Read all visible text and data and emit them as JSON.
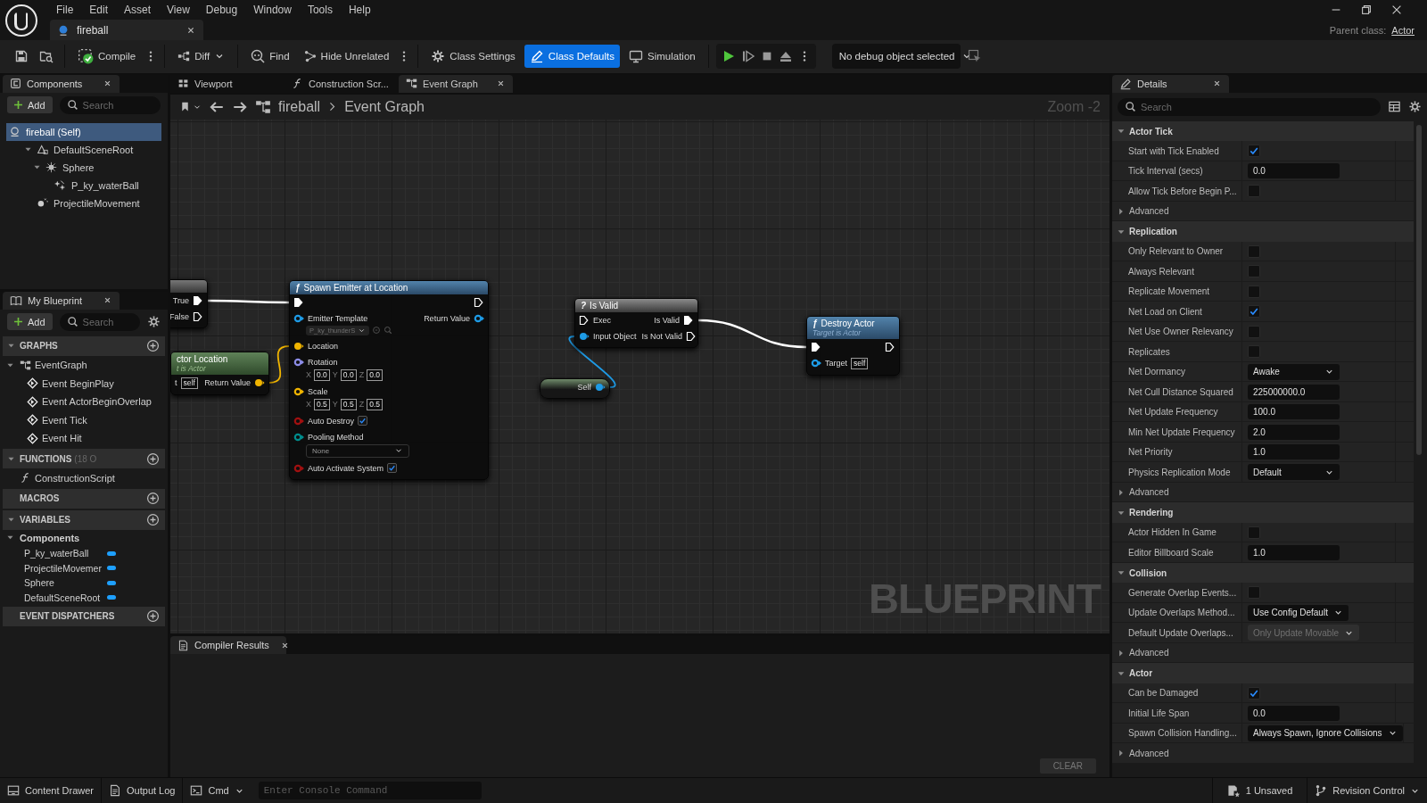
{
  "menu": [
    "File",
    "Edit",
    "Asset",
    "View",
    "Debug",
    "Window",
    "Tools",
    "Help"
  ],
  "asset_tab": {
    "label": "fireball"
  },
  "parent_class": {
    "label": "Parent class:",
    "value": "Actor"
  },
  "toolbar": {
    "compile": "Compile",
    "diff": "Diff",
    "find": "Find",
    "hide_unrelated": "Hide Unrelated",
    "modes": [
      {
        "kind": "settings",
        "label": "Class Settings",
        "selected": false
      },
      {
        "kind": "defaults",
        "label": "Class Defaults",
        "selected": true
      },
      {
        "kind": "simulation",
        "label": "Simulation",
        "selected": false
      }
    ],
    "debug_object": "No debug object selected"
  },
  "components": {
    "title": "Components",
    "add": "Add",
    "search_placeholder": "Search",
    "tree": [
      {
        "kind": "actor",
        "label": "fireball (Self)",
        "selected": true,
        "children": [
          {
            "kind": "scene_root",
            "label": "DefaultSceneRoot",
            "selected": false,
            "children": [
              {
                "kind": "mesh",
                "label": "Sphere",
                "selected": false,
                "children": [
                  {
                    "kind": "particles",
                    "label": "P_ky_waterBall",
                    "selected": false
                  }
                ]
              }
            ]
          },
          {
            "kind": "movement",
            "label": "ProjectileMovement",
            "selected": false
          }
        ]
      }
    ]
  },
  "my_blueprint": {
    "title": "My Blueprint",
    "add": "Add",
    "search_placeholder": "Search",
    "sections": [
      {
        "title": "GRAPHS",
        "items": [
          {
            "kind": "graph",
            "label": "EventGraph",
            "children": [
              {
                "kind": "event",
                "label": "Event BeginPlay"
              },
              {
                "kind": "event",
                "label": "Event ActorBeginOverlap"
              },
              {
                "kind": "event",
                "label": "Event Tick"
              },
              {
                "kind": "event",
                "label": "Event Hit"
              }
            ]
          }
        ]
      },
      {
        "title": "FUNCTIONS",
        "note": "(18 O",
        "items": [
          {
            "kind": "function",
            "label": "ConstructionScript"
          }
        ]
      },
      {
        "title": "MACROS"
      },
      {
        "title": "VARIABLES",
        "items": [
          {
            "kind": "category",
            "label": "Components",
            "children": [
              {
                "kind": "variable",
                "label": "P_ky_waterBall"
              },
              {
                "kind": "variable",
                "label": "ProjectileMovemer"
              },
              {
                "kind": "variable",
                "label": "Sphere"
              },
              {
                "kind": "variable",
                "label": "DefaultSceneRoot"
              }
            ]
          }
        ]
      },
      {
        "title": "EVENT DISPATCHERS"
      }
    ]
  },
  "editor_tabs": [
    {
      "kind": "viewport",
      "label": "Viewport",
      "selected": false
    },
    {
      "kind": "function",
      "label": "Construction Scr...",
      "selected": false
    },
    {
      "kind": "graph",
      "label": "Event Graph",
      "selected": true
    }
  ],
  "breadcrumb": [
    "fireball",
    "Event Graph"
  ],
  "zoom": "Zoom -2",
  "graph": {
    "watermark": "BLUEPRINT",
    "nodes": [
      {
        "kind": "branch",
        "rows": [
          {
            "right": {
              "kind": "exec",
              "label": "True",
              "connected": true
            }
          },
          {
            "right": {
              "kind": "exec",
              "label": "False",
              "connected": false
            }
          }
        ]
      },
      {
        "kind": "pure",
        "title": "ctor Location",
        "subtitle": "t is Actor",
        "rows": [
          {
            "left": {
              "kind": "bare",
              "label": "t",
              "widget": {
                "kind": "text",
                "value": "self"
              }
            },
            "right": {
              "kind": "data",
              "label": "Return Value",
              "color": "#f0b400",
              "connected": true
            }
          }
        ]
      },
      {
        "kind": "function",
        "icon": "ƒ",
        "title": "Spawn Emitter at Location",
        "rows": [
          {
            "left": {
              "kind": "exec",
              "connected": true
            },
            "right": {
              "kind": "exec",
              "connected": false
            }
          },
          {
            "left": {
              "kind": "data",
              "label": "Emitter Template",
              "color": "#1e9be6",
              "connected": false,
              "widget": {
                "kind": "asset",
                "value": "P_ky_thunderS"
              }
            },
            "right": {
              "kind": "data",
              "label": "Return Value",
              "color": "#1e9be6",
              "connected": false
            }
          },
          {
            "left": {
              "kind": "data",
              "label": "Location",
              "color": "#f0b400",
              "connected": true
            }
          },
          {
            "left": {
              "kind": "data",
              "label": "Rotation",
              "color": "#8c8ce6",
              "connected": false,
              "widget": {
                "kind": "vector",
                "fields": [
                  {
                    "axis": "X",
                    "value": "0.0"
                  },
                  {
                    "axis": "Y",
                    "value": "0.0"
                  },
                  {
                    "axis": "Z",
                    "value": "0.0"
                  }
                ]
              }
            }
          },
          {
            "left": {
              "kind": "data",
              "label": "Scale",
              "color": "#f0b400",
              "connected": false,
              "widget": {
                "kind": "vector",
                "fields": [
                  {
                    "axis": "X",
                    "value": "0.5"
                  },
                  {
                    "axis": "Y",
                    "value": "0.5"
                  },
                  {
                    "axis": "Z",
                    "value": "0.5"
                  }
                ]
              }
            }
          },
          {
            "left": {
              "kind": "data",
              "label": "Auto Destroy",
              "color": "#a01010",
              "connected": false,
              "widget": {
                "kind": "checkbox",
                "checked": true
              }
            }
          },
          {
            "left": {
              "kind": "data",
              "label": "Pooling Method",
              "color": "#008c8c",
              "connected": false,
              "widget": {
                "kind": "dropdown",
                "value": "None"
              }
            }
          },
          {
            "left": {
              "kind": "data",
              "label": "Auto Activate System",
              "color": "#a01010",
              "connected": false,
              "widget": {
                "kind": "checkbox",
                "checked": true
              }
            }
          }
        ]
      },
      {
        "kind": "macro",
        "icon": "?",
        "title": "Is Valid",
        "rows": [
          {
            "left": {
              "kind": "exec",
              "label": "Exec",
              "connected": false
            },
            "right": {
              "kind": "exec",
              "label": "Is Valid",
              "connected": true
            }
          },
          {
            "left": {
              "kind": "data",
              "label": "Input Object",
              "color": "#1e9be6",
              "connected": true
            },
            "right": {
              "kind": "exec",
              "label": "Is Not Valid",
              "connected": false
            }
          }
        ]
      },
      {
        "kind": "self",
        "rows": [
          {
            "right": {
              "kind": "data",
              "label": "Self",
              "color": "#1e9be6",
              "connected": true
            }
          }
        ]
      },
      {
        "kind": "function",
        "icon": "ƒ",
        "title": "Destroy Actor",
        "subtitle": "Target is Actor",
        "rows": [
          {
            "left": {
              "kind": "exec",
              "connected": true
            },
            "right": {
              "kind": "exec",
              "connected": false
            }
          },
          {
            "left": {
              "kind": "data",
              "label": "Target",
              "color": "#1e9be6",
              "connected": false,
              "widget": {
                "kind": "text",
                "value": "self"
              }
            }
          }
        ]
      }
    ]
  },
  "compiler": {
    "title": "Compiler Results",
    "clear": "CLEAR"
  },
  "details": {
    "title": "Details",
    "search_placeholder": "Search",
    "categories": [
      {
        "title": "Actor Tick",
        "rows": [
          {
            "kind": "checkbox",
            "label": "Start with Tick Enabled",
            "checked": true
          },
          {
            "kind": "number",
            "label": "Tick Interval (secs)",
            "value": "0.0"
          },
          {
            "kind": "checkbox",
            "label": "Allow Tick Before Begin P...",
            "checked": false
          },
          {
            "kind": "advanced",
            "label": "Advanced"
          }
        ]
      },
      {
        "title": "Replication",
        "rows": [
          {
            "kind": "checkbox",
            "label": "Only Relevant to Owner",
            "checked": false
          },
          {
            "kind": "checkbox",
            "label": "Always Relevant",
            "checked": false
          },
          {
            "kind": "checkbox",
            "label": "Replicate Movement",
            "checked": false
          },
          {
            "kind": "checkbox",
            "label": "Net Load on Client",
            "checked": true
          },
          {
            "kind": "checkbox",
            "label": "Net Use Owner Relevancy",
            "checked": false
          },
          {
            "kind": "checkbox",
            "label": "Replicates",
            "checked": false
          },
          {
            "kind": "dropdown",
            "label": "Net Dormancy",
            "value": "Awake",
            "disabled": false
          },
          {
            "kind": "number",
            "label": "Net Cull Distance Squared",
            "value": "225000000.0"
          },
          {
            "kind": "number",
            "label": "Net Update Frequency",
            "value": "100.0"
          },
          {
            "kind": "number",
            "label": "Min Net Update Frequency",
            "value": "2.0"
          },
          {
            "kind": "number",
            "label": "Net Priority",
            "value": "1.0"
          },
          {
            "kind": "dropdown",
            "label": "Physics Replication Mode",
            "value": "Default",
            "disabled": false
          },
          {
            "kind": "advanced",
            "label": "Advanced"
          }
        ]
      },
      {
        "title": "Rendering",
        "rows": [
          {
            "kind": "checkbox",
            "label": "Actor Hidden In Game",
            "checked": false
          },
          {
            "kind": "number",
            "label": "Editor Billboard Scale",
            "value": "1.0"
          }
        ]
      },
      {
        "title": "Collision",
        "rows": [
          {
            "kind": "checkbox",
            "label": "Generate Overlap Events...",
            "checked": false
          },
          {
            "kind": "dropdown",
            "label": "Update Overlaps Method...",
            "value": "Use Config Default",
            "disabled": false
          },
          {
            "kind": "dropdown",
            "label": "Default Update Overlaps...",
            "value": "Only Update Movable",
            "disabled": true
          },
          {
            "kind": "advanced",
            "label": "Advanced"
          }
        ]
      },
      {
        "title": "Actor",
        "rows": [
          {
            "kind": "checkbox",
            "label": "Can be Damaged",
            "checked": true
          },
          {
            "kind": "number",
            "label": "Initial Life Span",
            "value": "0.0"
          },
          {
            "kind": "dropdown",
            "label": "Spawn Collision Handling...",
            "value": "Always Spawn, Ignore Collisions",
            "disabled": false
          },
          {
            "kind": "advanced",
            "label": "Advanced"
          }
        ]
      }
    ]
  },
  "status_bar": {
    "content_drawer": "Content Drawer",
    "output_log": "Output Log",
    "cmd": "Cmd",
    "console_placeholder": "Enter Console Command",
    "unsaved": "1 Unsaved",
    "revision_control": "Revision Control"
  }
}
